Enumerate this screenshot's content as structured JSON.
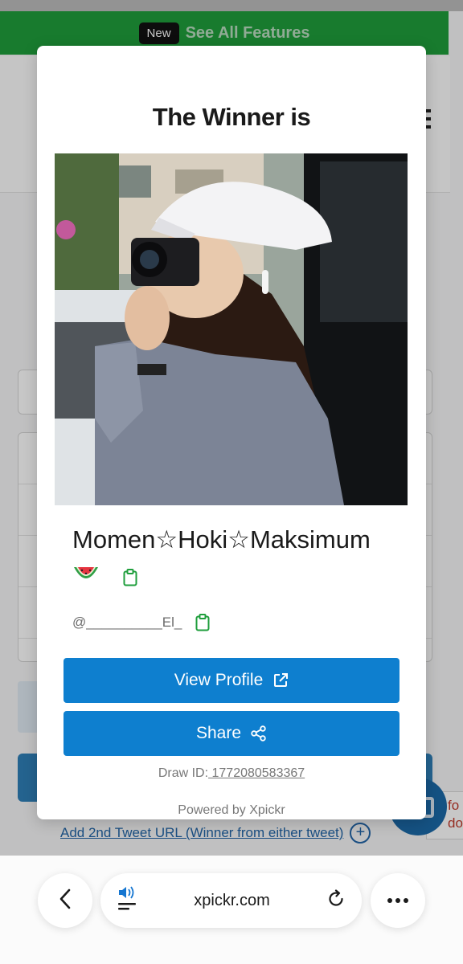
{
  "background": {
    "new_badge": "New",
    "banner_text": "See All Features",
    "add_tweet_link": "Add 2nd Tweet URL (Winner from either tweet)",
    "add_icon": "plus-circle-icon",
    "side_notice": "fo\ndo"
  },
  "modal": {
    "title": "The Winner is",
    "winner_name": "Momen☆Hoki☆Maksimum",
    "emoji": "watermelon-icon",
    "handle": "@__________El_",
    "copy_icon": "clipboard-icon",
    "view_profile_label": "View Profile",
    "share_label": "Share",
    "draw_id_label": "Draw ID:",
    "draw_id_value": " 1772080583367",
    "powered_by": "Powered by Xpickr"
  },
  "browser": {
    "url": "xpickr.com",
    "icons": [
      "chevron-left-icon",
      "speaker-icon",
      "reload-icon",
      "more-icon"
    ]
  },
  "colors": {
    "banner_green": "#1f9e3c",
    "button_blue": "#0e7fcf",
    "copy_green": "#1f9e3c"
  }
}
